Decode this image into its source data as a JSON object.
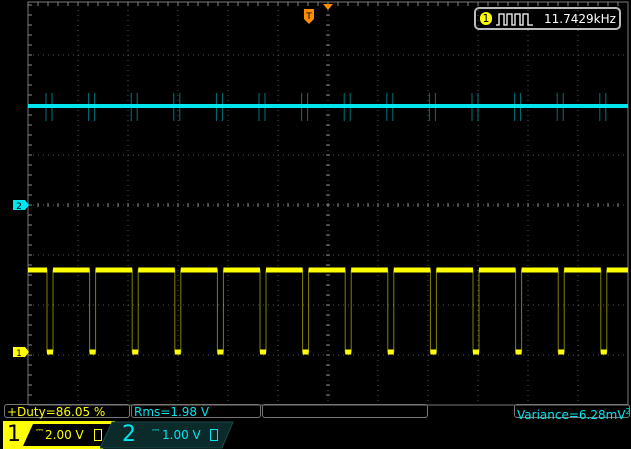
{
  "trigger": {
    "label": "T",
    "color": "#ff8c00"
  },
  "frequency": {
    "channel": "1",
    "value": "11.7429kHz",
    "icon": "square-wave-icon"
  },
  "channels": [
    {
      "number": "1",
      "scale": "2.00 V",
      "coupling": "dc-icon",
      "color": "#ffff00",
      "marker": "1"
    },
    {
      "number": "2",
      "scale": "1.00 V",
      "coupling": "dc-icon",
      "color": "#00e5ee",
      "marker": "2"
    }
  ],
  "measurements": {
    "duty": "+Duty=86.05 %",
    "rms": "Rms=1.98 V",
    "variance": "Variance=6.28mV",
    "variance_sup": "2"
  },
  "colors": {
    "ch1": "#ffff00",
    "ch2": "#00e5ee",
    "grid": "#555555"
  }
}
